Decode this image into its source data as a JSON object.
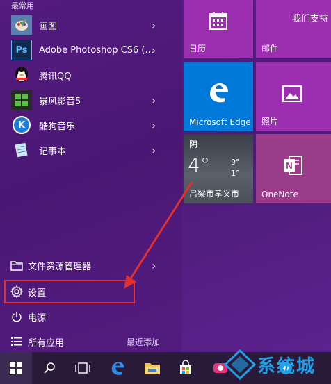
{
  "left_menu": {
    "section_label": "最常用",
    "apps": [
      {
        "label": "画图",
        "icon": "paint-icon"
      },
      {
        "label": "Adobe Photoshop CS6 (...",
        "icon": "photoshop-icon",
        "icon_text": "Ps"
      },
      {
        "label": "腾讯QQ",
        "icon": "qq-icon"
      },
      {
        "label": "暴风影音5",
        "icon": "baofeng-icon"
      },
      {
        "label": "酷狗音乐",
        "icon": "kugou-icon",
        "icon_text": "K"
      },
      {
        "label": "记事本",
        "icon": "notepad-icon"
      }
    ],
    "system": {
      "file_explorer": "文件资源管理器",
      "settings": "设置",
      "power": "电源",
      "all_apps": "所有应用",
      "recently_added": "最近添加"
    }
  },
  "tiles": {
    "calendar": "日历",
    "mail_header": "我们支持",
    "mail": "邮件",
    "edge": "Microsoft Edge",
    "photos": "照片",
    "weather": {
      "condition": "阴",
      "temp": "4°",
      "high": "9°",
      "low": "1°",
      "location": "吕梁市孝义市"
    },
    "onenote": "OneNote"
  },
  "taskbar": {
    "items": [
      "start-icon",
      "search-icon",
      "task-view-icon",
      "edge-icon",
      "file-explorer-icon",
      "store-icon",
      "app-icon",
      "app-icon-2"
    ],
    "watermark": "系统城"
  },
  "colors": {
    "tile_purple": "#9c2fb0",
    "tile_blue": "#0078d7",
    "highlight_red": "#e0302f"
  }
}
